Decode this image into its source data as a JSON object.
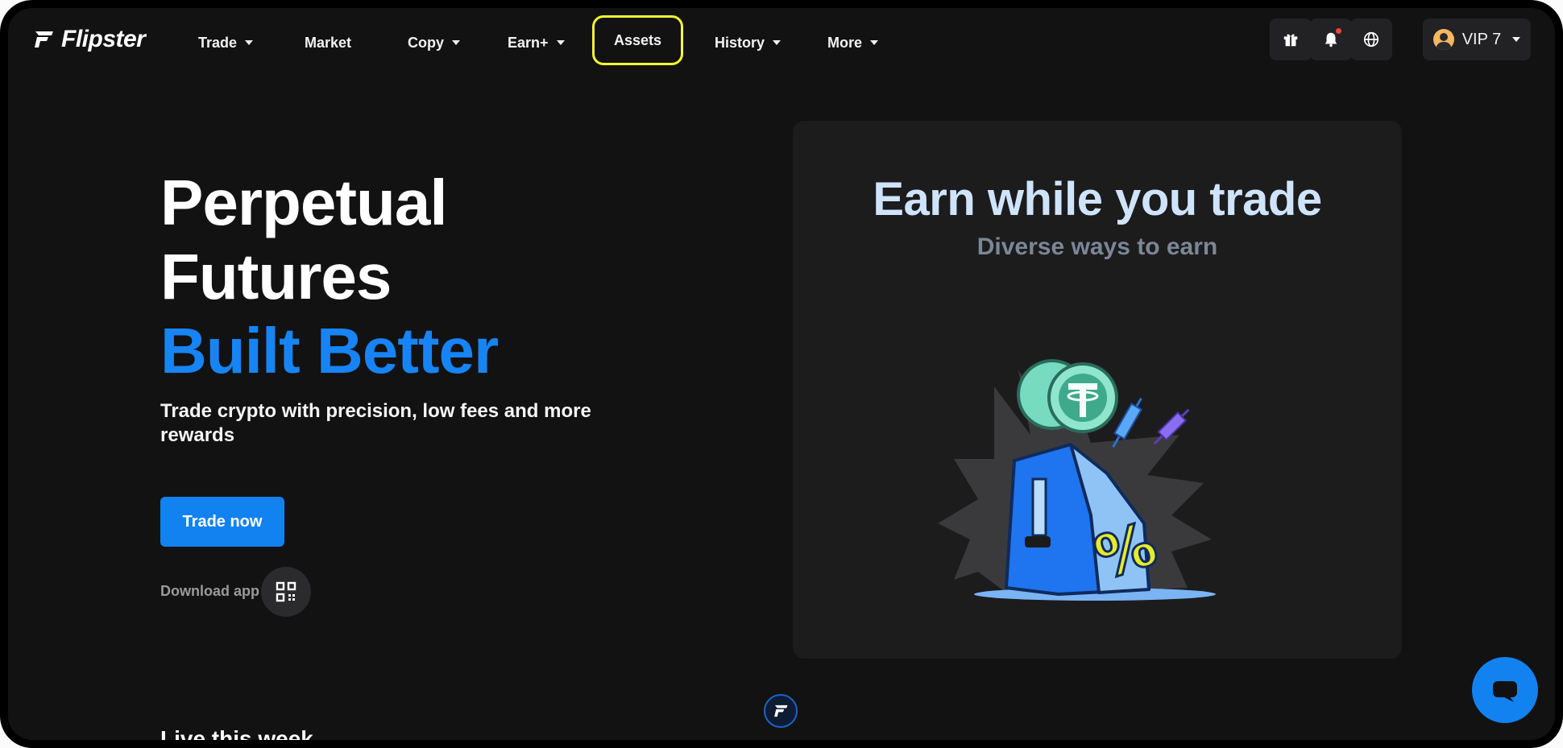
{
  "brand": {
    "name": "Flipster"
  },
  "nav": {
    "items": [
      {
        "label": "Trade",
        "dropdown": true
      },
      {
        "label": "Market",
        "dropdown": false
      },
      {
        "label": "Copy",
        "dropdown": true
      },
      {
        "label": "Earn+",
        "dropdown": true
      },
      {
        "label": "Assets",
        "dropdown": false
      },
      {
        "label": "History",
        "dropdown": true
      },
      {
        "label": "More",
        "dropdown": true
      }
    ],
    "icons": [
      "gift-icon",
      "bell-icon",
      "globe-icon"
    ],
    "vip_label": "VIP 7"
  },
  "hero": {
    "line1": "Perpetual",
    "line2": "Futures",
    "line3": "Built Better",
    "subtitle": "Trade crypto with precision, low fees and more rewards",
    "cta": "Trade now",
    "download_label": "Download app"
  },
  "promo": {
    "title": "Earn while you trade",
    "subtitle": "Diverse ways to earn",
    "badge": "%"
  },
  "peek_text": "Live this week",
  "colors": {
    "accent": "#1784f5",
    "highlight": "#f5f533",
    "background": "#121212",
    "card": "#1c1c1d"
  }
}
